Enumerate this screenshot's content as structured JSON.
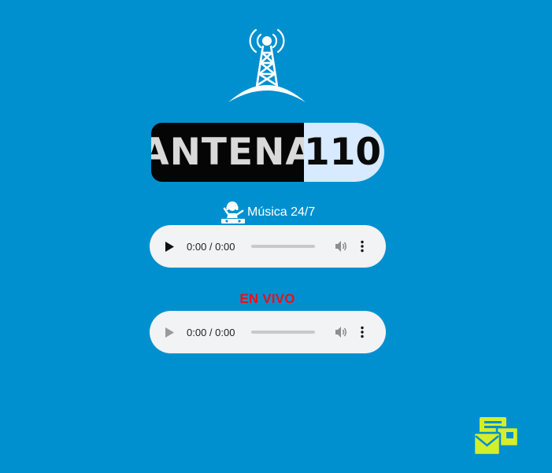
{
  "logo": {
    "left_text": "ANTENA",
    "right_text": "110"
  },
  "music": {
    "label": "Música 24/7",
    "icon": "dj-icon"
  },
  "players": [
    {
      "time": "0:00 / 0:00",
      "enabled": true
    },
    {
      "time": "0:00 / 0:00",
      "enabled": false
    }
  ],
  "live": {
    "label": "EN VIVO"
  },
  "colors": {
    "background": "#0090cf",
    "live": "#e8101a",
    "contact_icon": "#d4ee2a"
  }
}
